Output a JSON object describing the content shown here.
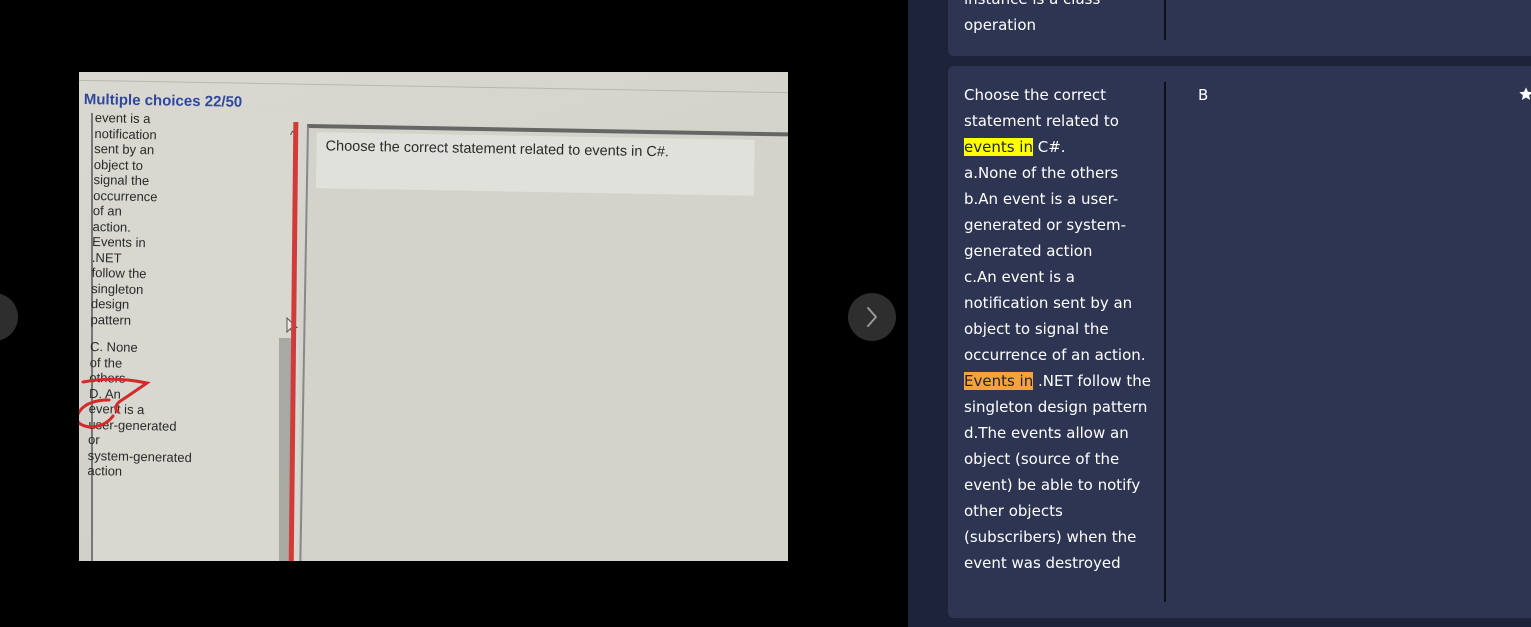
{
  "viewer": {
    "photo": {
      "title": "Multiple choices 22/50",
      "question": "Choose the correct statement related to events in C#.",
      "options_block_1": "event is a\nnotification\nsent by an\nobject to\nsignal the\noccurrence\nof an\naction.\nEvents in\n.NET\nfollow the\nsingleton\ndesign\npattern",
      "options_block_2": "C. None\nof the\nothers",
      "options_block_3": "D. An\nevent is a\nuser-generated\nor\nsystem-generated\naction"
    },
    "next_icon": "chevron-right-icon",
    "prev_icon": "chevron-left-icon"
  },
  "cards": {
    "previous": {
      "term_line_1": "instance is a class",
      "term_line_2": "operation"
    },
    "current": {
      "term_p1": "Choose the correct statement related to ",
      "term_hl1": "events in",
      "term_p2": " C#.",
      "option_a": "a.None of the others",
      "option_b": "b.An event is a user-generated or system-generated action",
      "option_c_p1": "c.An event is a notification sent by an object to signal the occurrence of an action. ",
      "option_c_hl": "Events in",
      "option_c_p2": " .NET follow the singleton design pattern",
      "option_d": "d.The events allow an object (source of the event) be able to notify other objects (subscribers) when the event was destroyed",
      "answer": "B",
      "star_icon": "star-icon"
    }
  },
  "colors": {
    "panel_bg": "#1d2339",
    "card_bg": "#2d3553",
    "highlight_yellow": "#ffff00",
    "highlight_orange": "#f4a23a",
    "photo_title": "#2f47a0"
  }
}
